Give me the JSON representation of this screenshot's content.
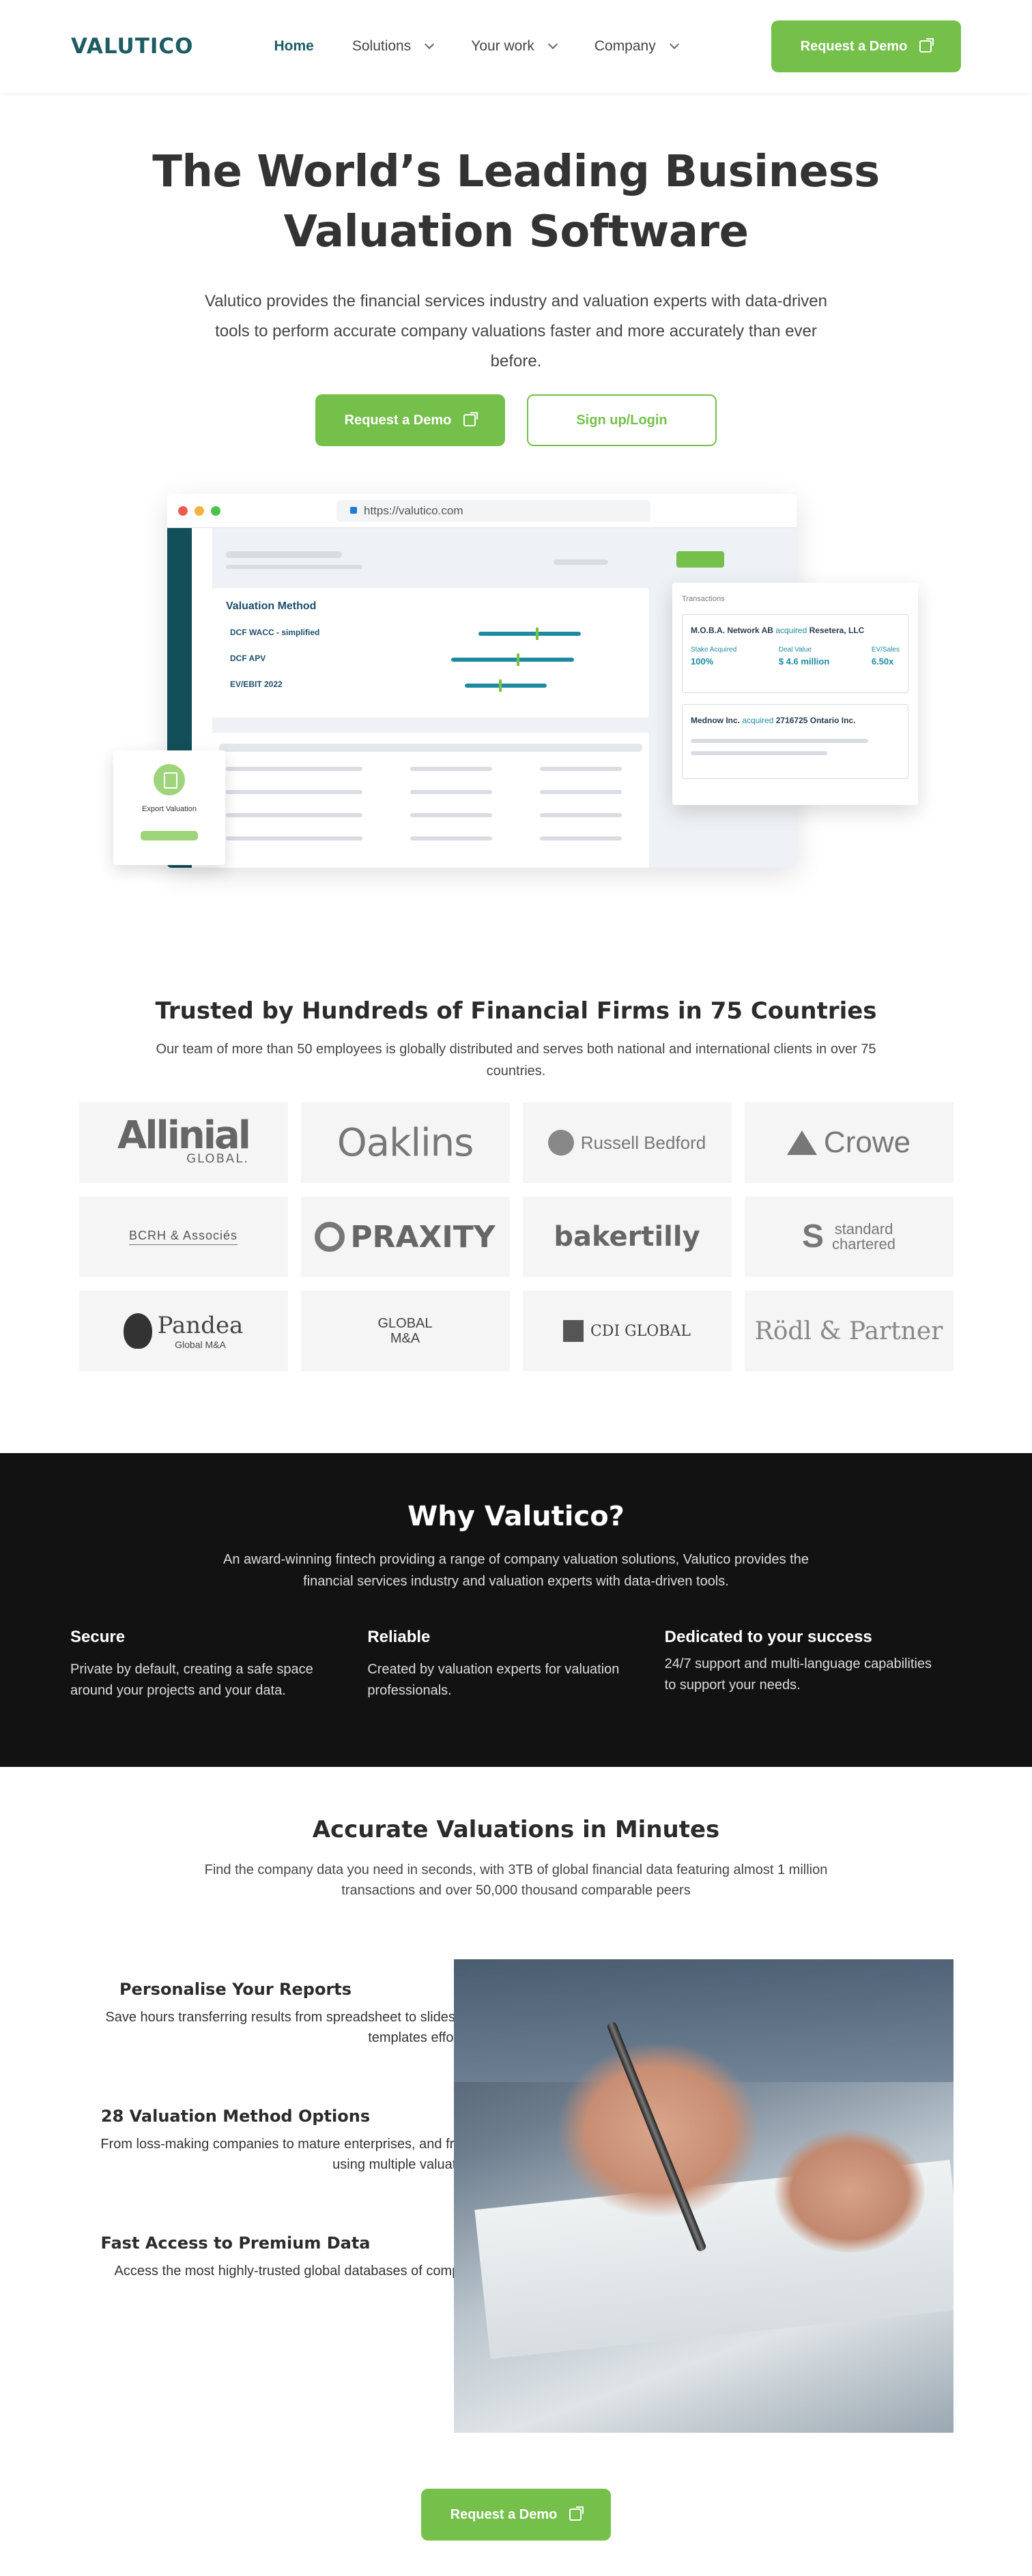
{
  "nav": {
    "logo": "VALUTICO",
    "items": [
      {
        "label": "Home"
      },
      {
        "label": "Solutions"
      },
      {
        "label": "Your work"
      },
      {
        "label": "Company"
      }
    ],
    "cta": "Request a Demo"
  },
  "hero": {
    "title_line1": "The World’s Leading Business",
    "title_line2": "Valuation Software",
    "description": "Valutico provides the financial services industry and valuation experts with data-driven tools to perform accurate company valuations faster and more accurately than ever before.",
    "cta_primary": "Request a Demo",
    "cta_secondary": "Sign up/Login"
  },
  "mockup": {
    "url": "https://valutico.com",
    "valuation_method_title": "Valuation Method",
    "methods": [
      "DCF WACC - simplified",
      "DCF APV",
      "EV/EBIT 2022"
    ],
    "transactions_title": "Transactions",
    "tx1_acquirer": "M.O.B.A. Network AB",
    "tx1_verb": "acquired",
    "tx1_target": "Resetera, LLC",
    "tx1_stats": [
      {
        "label": "Stake Acquired",
        "value": "100%"
      },
      {
        "label": "Deal Value",
        "value": "$ 4.6 million"
      },
      {
        "label": "EV/Sales",
        "value": "6.50x"
      }
    ],
    "tx2_acquirer": "Mednow Inc.",
    "tx2_verb": "acquired",
    "tx2_target": "2716725 Ontario Inc.",
    "export_label": "Export Valuation"
  },
  "trusted": {
    "title": "Trusted by Hundreds of Financial Firms in 75 Countries",
    "description": "Our team of more than 50 employees is globally distributed and serves both national and international clients in over 75 countries.",
    "logos": {
      "allinial": "Allinial",
      "allinial_sub": "GLOBAL.",
      "oaklins": "Oaklins",
      "russell": "Russell Bedford",
      "crowe": "Crowe",
      "bcrh": "BCRH & Associés",
      "praxity": "PRAXITY",
      "bakertilly": "bakertilly",
      "sc_line1": "standard",
      "sc_line2": "chartered",
      "pandea": "Pandea",
      "pandea_sub": "Global M&A",
      "gma_line1": "GLOBAL",
      "gma_line2": "M&A",
      "cdi": "CDI GLOBAL",
      "rodl": "Rödl & Partner"
    }
  },
  "why": {
    "title": "Why Valutico?",
    "lead": "An award-winning fintech providing a range of company valuation solutions, Valutico provides the financial services industry and valuation experts with data-driven tools.",
    "cols": [
      {
        "title": "Secure",
        "text": "Private by default, creating a safe space around your projects and your data."
      },
      {
        "title": "Reliable",
        "text": "Created by valuation experts for valuation professionals."
      },
      {
        "title": "Dedicated to your success",
        "text": "24/7 support and multi-language capabilities to support your  needs."
      }
    ]
  },
  "accurate": {
    "title": "Accurate Valuations in Minutes",
    "description": "Find the company data you need in seconds, with 3TB of global financial data featuring almost 1 million transactions and over 50,000 thousand comparable peers",
    "features": [
      {
        "title": "Personalise Your Reports",
        "text": "Save hours transferring results from spreadsheet to slides, by exporting your results to Powerpoint and Word templates effortlessly."
      },
      {
        "title": "28 Valuation Method Options",
        "text": "From loss-making companies to mature enterprises, and from startups to SME's, value businesses of any type using multiple valuation methods."
      },
      {
        "title": "Fast Access to Premium Data",
        "text": "Access the most highly-trusted global databases of company financial data to locate the figures you need."
      }
    ],
    "cta": "Request a Demo"
  }
}
